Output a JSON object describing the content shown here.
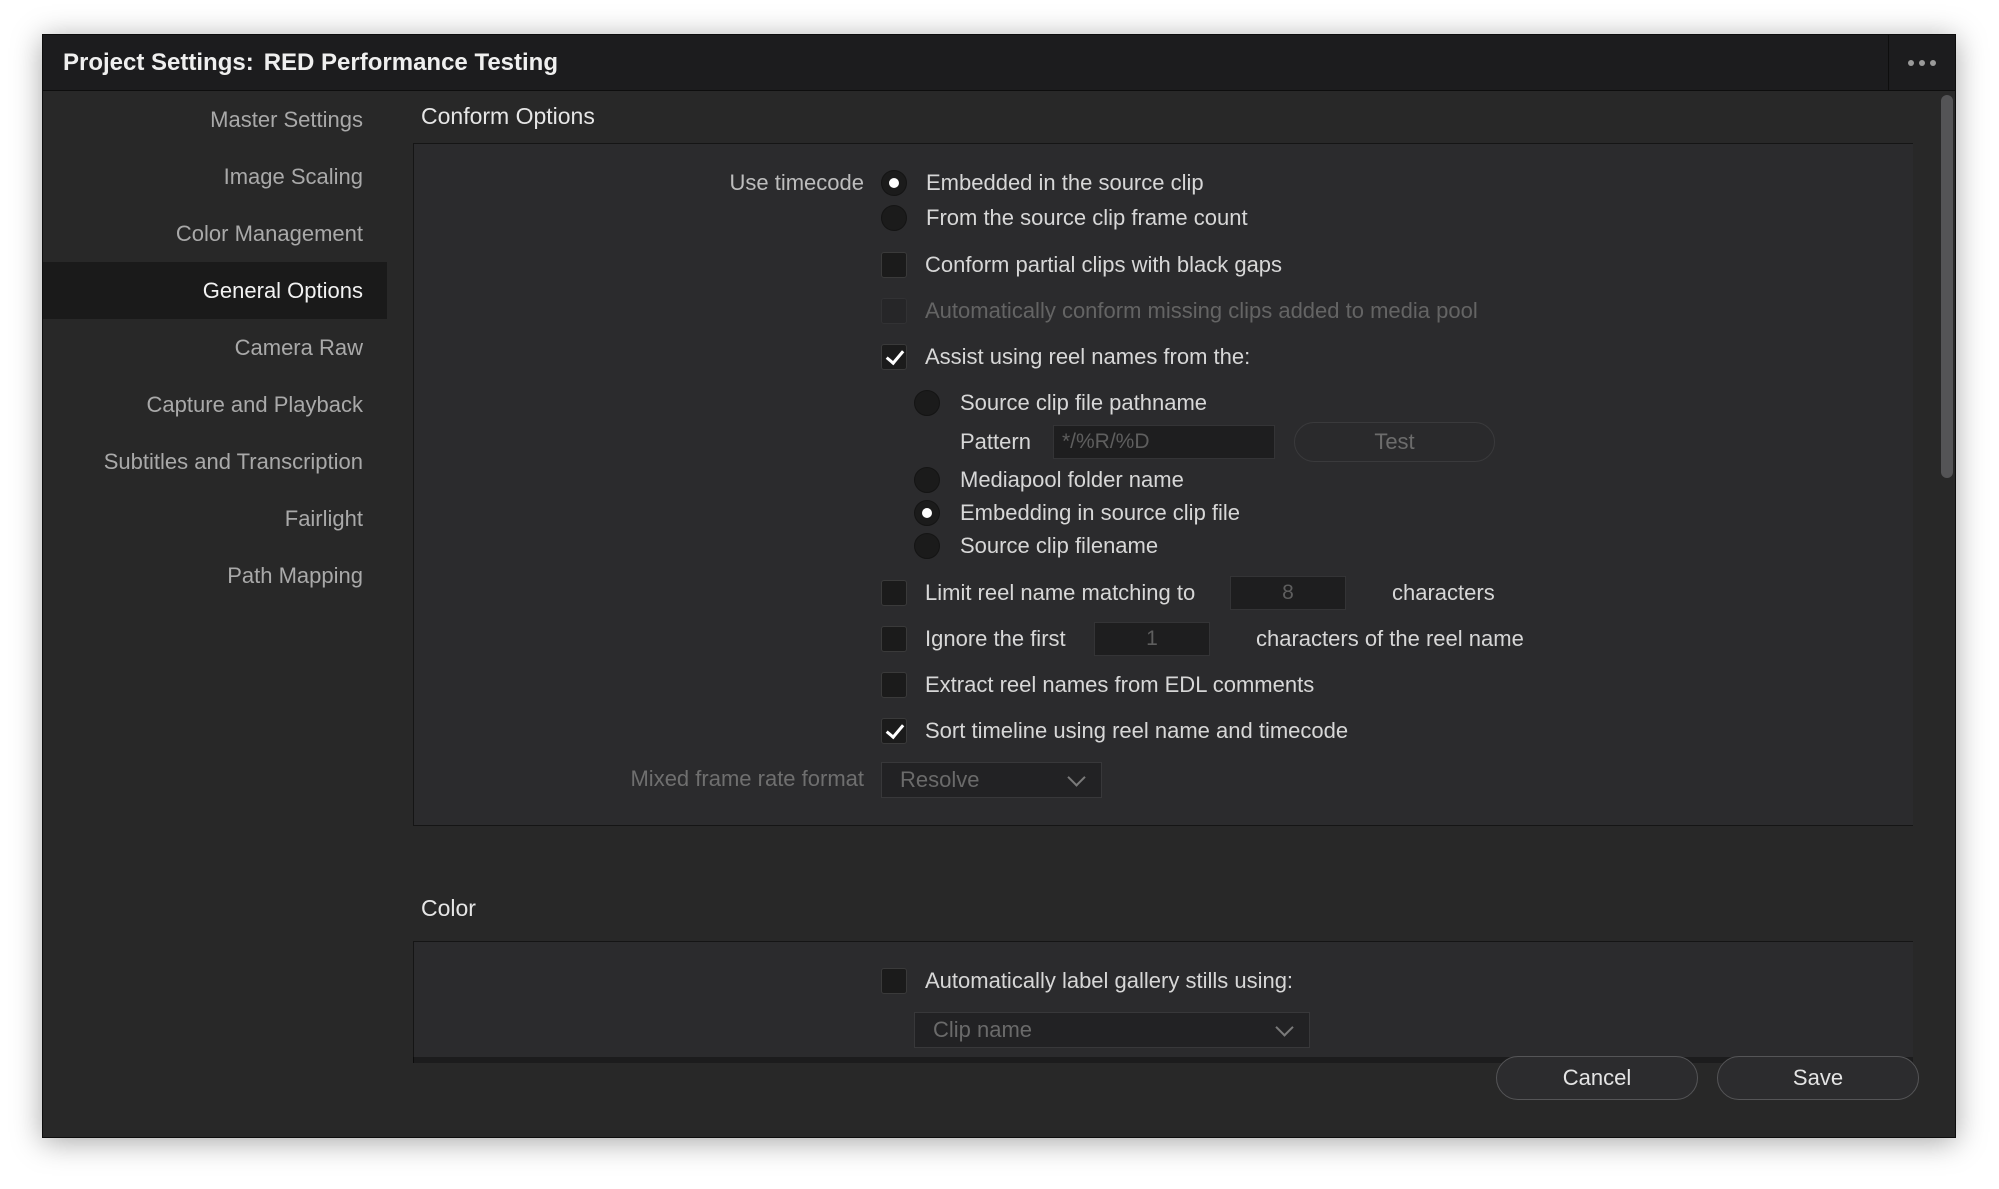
{
  "window": {
    "title_prefix": "Project Settings:",
    "project_name": "RED Performance Testing"
  },
  "sidebar": {
    "items": [
      {
        "label": "Master Settings"
      },
      {
        "label": "Image Scaling"
      },
      {
        "label": "Color Management"
      },
      {
        "label": "General Options",
        "active": true
      },
      {
        "label": "Camera Raw"
      },
      {
        "label": "Capture and Playback"
      },
      {
        "label": "Subtitles and Transcription"
      },
      {
        "label": "Fairlight"
      },
      {
        "label": "Path Mapping"
      }
    ]
  },
  "conform": {
    "section_title": "Conform Options",
    "use_timecode_label": "Use timecode",
    "timecode_embedded": "Embedded in the source clip",
    "timecode_frame_count": "From the source clip frame count",
    "partial_clips": "Conform partial clips with black gaps",
    "auto_conform_missing": "Automatically conform missing clips added to media pool",
    "assist_reel_names": "Assist using reel names from the:",
    "source_pathname": "Source clip file pathname",
    "pattern_label": "Pattern",
    "pattern_placeholder": "*/%R/%D",
    "test_button": "Test",
    "mediapool_folder": "Mediapool folder name",
    "embedding_source": "Embedding in source clip file",
    "source_filename": "Source clip filename",
    "limit_reel_label": "Limit reel name matching to",
    "limit_reel_value": "8",
    "limit_reel_suffix": "characters",
    "ignore_first_label": "Ignore the first",
    "ignore_first_value": "1",
    "ignore_first_suffix": "characters of the reel name",
    "extract_edl": "Extract reel names from EDL comments",
    "sort_timeline": "Sort timeline using reel name and timecode",
    "mixed_frame_label": "Mixed frame rate format",
    "mixed_frame_value": "Resolve"
  },
  "color": {
    "section_title": "Color",
    "auto_label_stills": "Automatically label gallery stills using:",
    "label_source_value": "Clip name"
  },
  "footer": {
    "cancel": "Cancel",
    "save": "Save"
  }
}
